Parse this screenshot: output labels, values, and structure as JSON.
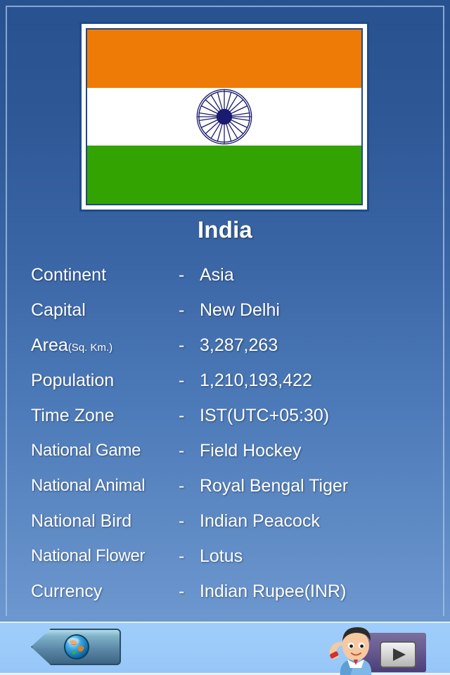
{
  "country": {
    "name": "India",
    "flag": {
      "icon": "india-flag",
      "bands": [
        "#ee7b06",
        "#ffffff",
        "#33a302"
      ],
      "emblem": "ashoka-chakra",
      "emblem_color": "#1a1a6e",
      "spokes": 24
    }
  },
  "facts": [
    {
      "label": "Continent",
      "unit": "",
      "dash": "-",
      "value": "Asia"
    },
    {
      "label": "Capital",
      "unit": "",
      "dash": "-",
      "value": "New Delhi"
    },
    {
      "label": "Area",
      "unit": "(Sq. Km.)",
      "dash": "-",
      "value": "3,287,263"
    },
    {
      "label": "Population",
      "unit": "",
      "dash": "-",
      "value": "1,210,193,422"
    },
    {
      "label": "Time Zone",
      "unit": "",
      "dash": "-",
      "value": "IST(UTC+05:30)"
    },
    {
      "label": "National Game",
      "unit": "",
      "dash": "-",
      "value": "Field Hockey"
    },
    {
      "label": "National Animal",
      "unit": "",
      "dash": "-",
      "value": "Royal Bengal Tiger"
    },
    {
      "label": "National Bird",
      "unit": "",
      "dash": "-",
      "value": "Indian Peacock"
    },
    {
      "label": "National Flower",
      "unit": "",
      "dash": "-",
      "value": "Lotus"
    },
    {
      "label": "Currency",
      "unit": "",
      "dash": "-",
      "value": "Indian Rupee(INR)"
    }
  ],
  "toolbar": {
    "back_button": {
      "icon": "globe-icon",
      "label": ""
    },
    "play_button": {
      "icon": "play-icon",
      "label": "",
      "mascot": "boy-saluting-icon"
    }
  },
  "theme": {
    "background_top": "#27518f",
    "background_bottom": "#6d97cf",
    "toolbar": "#9ecdfb",
    "text": "#ffffff",
    "frame_border": "#1f4a8c",
    "panel_purple": "#4b3d77"
  }
}
